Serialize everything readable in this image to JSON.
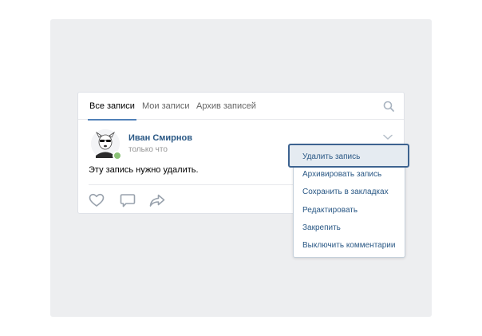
{
  "tabs": [
    {
      "label": "Все записи",
      "active": true
    },
    {
      "label": "Мои записи",
      "active": false
    },
    {
      "label": "Архив записей",
      "active": false
    }
  ],
  "post": {
    "author": "Иван Смирнов",
    "time": "только что",
    "text": "Эту запись нужно удалить."
  },
  "menu": {
    "items": [
      {
        "label": "Удалить запись",
        "highlighted": true
      },
      {
        "label": "Архивировать запись"
      },
      {
        "label": "Сохранить в закладках"
      },
      {
        "label": "Редактировать"
      },
      {
        "label": "Закрепить"
      },
      {
        "label": "Выключить комментарии"
      }
    ]
  },
  "colors": {
    "link": "#2a5885",
    "accent": "#5181b8",
    "online": "#8ac176",
    "highlight_border": "#3d6390"
  },
  "icons": {
    "search": "search-icon",
    "chevron": "chevron-down-icon",
    "like": "heart-icon",
    "comment": "comment-icon",
    "share": "share-icon"
  }
}
